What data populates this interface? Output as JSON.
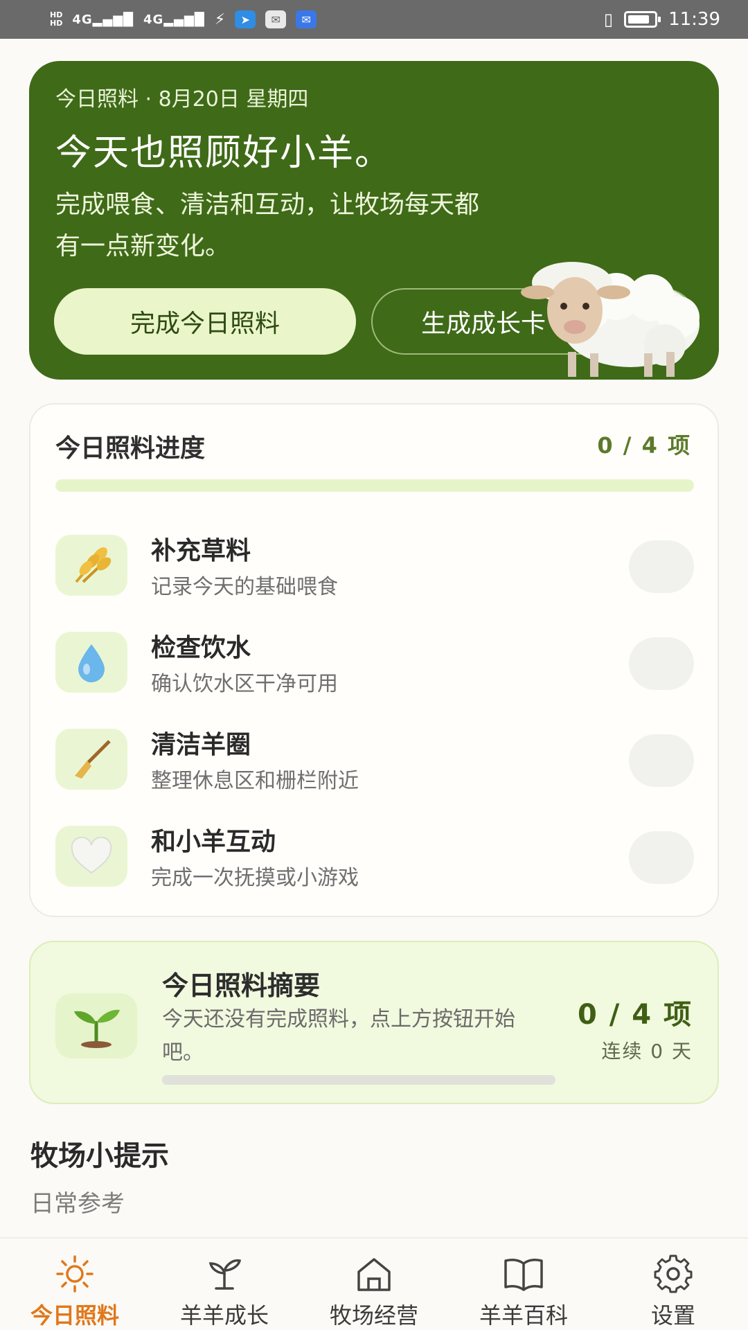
{
  "status_bar": {
    "hd_top": "HD",
    "hd_bottom": "HD",
    "signal_1": "4G",
    "signal_2": "4G",
    "time": "11:39"
  },
  "hero": {
    "date_line": "今日照料 · 8月20日 星期四",
    "title": "今天也照顾好小羊。",
    "description": "完成喂食、清洁和互动，让牧场每天都有一点新变化。",
    "primary_button": "完成今日照料",
    "secondary_button": "生成成长卡"
  },
  "progress": {
    "title": "今日照料进度",
    "count": "0 / 4 项",
    "fraction": 0,
    "tasks": [
      {
        "name": "补充草料",
        "sub": "记录今天的基础喂食",
        "icon": "wheat-icon"
      },
      {
        "name": "检查饮水",
        "sub": "确认饮水区干净可用",
        "icon": "water-drop-icon"
      },
      {
        "name": "清洁羊圈",
        "sub": "整理休息区和栅栏附近",
        "icon": "broom-icon"
      },
      {
        "name": "和小羊互动",
        "sub": "完成一次抚摸或小游戏",
        "icon": "heart-icon"
      }
    ]
  },
  "summary": {
    "title": "今日照料摘要",
    "text": "今天还没有完成照料，点上方按钮开始吧。",
    "count": "0 / 4 项",
    "streak": "连续 0 天",
    "icon": "sprout-icon"
  },
  "tips": {
    "title": "牧场小提示",
    "subtitle": "日常参考"
  },
  "nav": {
    "items": [
      {
        "label": "今日照料",
        "icon": "sun-icon",
        "active": true
      },
      {
        "label": "羊羊成长",
        "icon": "sprout-icon",
        "active": false
      },
      {
        "label": "牧场经营",
        "icon": "home-icon",
        "active": false
      },
      {
        "label": "羊羊百科",
        "icon": "book-icon",
        "active": false
      },
      {
        "label": "设置",
        "icon": "gear-icon",
        "active": false
      }
    ]
  },
  "colors": {
    "hero_bg": "#3f6a18",
    "accent_orange": "#e0781b",
    "primary_button_bg": "#eaf5c9"
  }
}
